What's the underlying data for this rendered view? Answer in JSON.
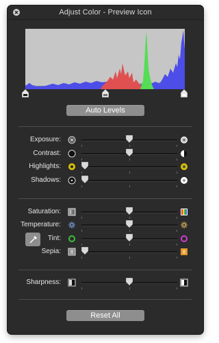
{
  "window": {
    "title": "Adjust Color - Preview Icon"
  },
  "histogram": {
    "colors": {
      "background": "#c6c6c6",
      "blue": "#4d4de8",
      "red": "#e05050",
      "green": "#55dd55",
      "gray": "#8c8c8c"
    }
  },
  "levels": {
    "black_point": 0.0,
    "gamma": 0.5,
    "white_point": 1.0
  },
  "buttons": {
    "auto_levels": "Auto Levels",
    "reset_all": "Reset All"
  },
  "sliders": [
    {
      "id": "exposure",
      "label": "Exposure:",
      "value": 0.5,
      "left_icon": "exposure-low-icon",
      "right_icon": "exposure-high-icon"
    },
    {
      "id": "contrast",
      "label": "Contrast:",
      "value": 0.5,
      "left_icon": "contrast-low-icon",
      "right_icon": "contrast-high-icon"
    },
    {
      "id": "highlights",
      "label": "Highlights:",
      "value": 0.0,
      "left_icon": "highlights-low-icon",
      "right_icon": "highlights-high-icon"
    },
    {
      "id": "shadows",
      "label": "Shadows:",
      "value": 0.0,
      "left_icon": "shadows-low-icon",
      "right_icon": "shadows-high-icon"
    },
    {
      "id": "saturation",
      "label": "Saturation:",
      "value": 0.5,
      "left_icon": "saturation-low-icon",
      "right_icon": "saturation-high-icon"
    },
    {
      "id": "temperature",
      "label": "Temperature:",
      "value": 0.5,
      "left_icon": "temperature-cool-icon",
      "right_icon": "temperature-warm-icon"
    },
    {
      "id": "tint",
      "label": "Tint:",
      "value": 0.5,
      "left_icon": "tint-green-icon",
      "right_icon": "tint-magenta-icon"
    },
    {
      "id": "sepia",
      "label": "Sepia:",
      "value": 0.0,
      "left_icon": "sepia-low-icon",
      "right_icon": "sepia-high-icon"
    },
    {
      "id": "sharpness",
      "label": "Sharpness:",
      "value": 0.5,
      "left_icon": "sharpness-low-icon",
      "right_icon": "sharpness-high-icon"
    }
  ]
}
